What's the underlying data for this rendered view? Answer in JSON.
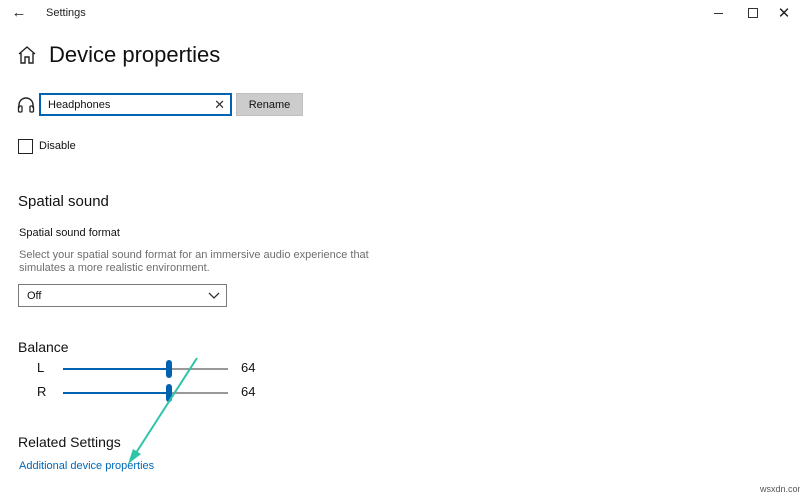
{
  "window": {
    "title": "Settings",
    "back_icon": "back-arrow-icon"
  },
  "page": {
    "title": "Device properties",
    "home_icon": "home-icon"
  },
  "device": {
    "icon": "headphones-icon",
    "name_value": "Headphones",
    "rename_label": "Rename",
    "disable_label": "Disable",
    "disable_checked": false
  },
  "spatial": {
    "title": "Spatial sound",
    "format_label": "Spatial sound format",
    "description_line1": "Select your spatial sound format for an immersive audio experience that",
    "description_line2": "simulates a more realistic environment.",
    "selected": "Off"
  },
  "balance": {
    "title": "Balance",
    "channels": [
      {
        "label": "L",
        "value": 64
      },
      {
        "label": "R",
        "value": 64
      }
    ],
    "max": 100
  },
  "related": {
    "title": "Related Settings",
    "link": "Additional device properties"
  },
  "colors": {
    "accent": "#0063b1",
    "link": "#0067b8",
    "annotation": "#2ec4a8"
  },
  "watermark": "wsxdn.com"
}
